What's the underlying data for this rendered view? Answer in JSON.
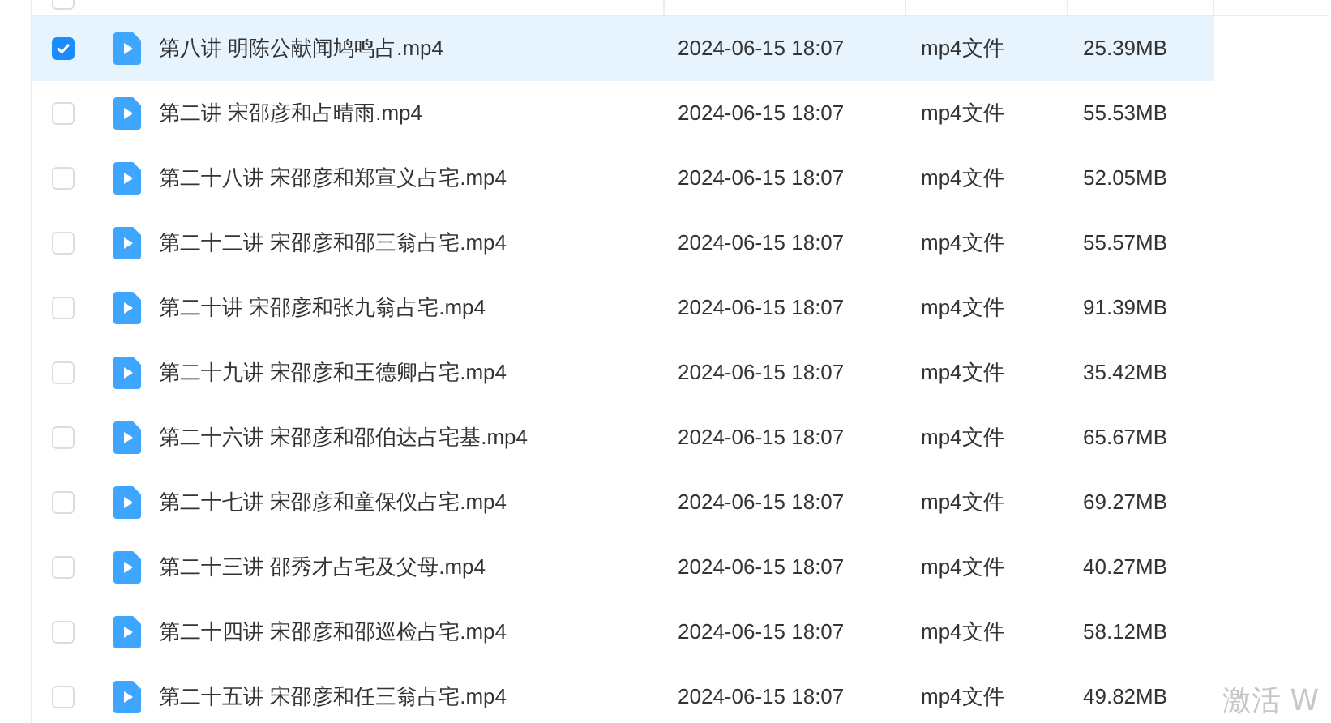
{
  "header": {
    "checked": false
  },
  "files": [
    {
      "name": "第八讲 明陈公献闻鸠鸣占.mp4",
      "modified": "2024-06-15 18:07",
      "type": "mp4文件",
      "size": "25.39MB",
      "selected": true
    },
    {
      "name": "第二讲 宋邵彦和占晴雨.mp4",
      "modified": "2024-06-15 18:07",
      "type": "mp4文件",
      "size": "55.53MB",
      "selected": false
    },
    {
      "name": "第二十八讲 宋邵彦和郑宣义占宅.mp4",
      "modified": "2024-06-15 18:07",
      "type": "mp4文件",
      "size": "52.05MB",
      "selected": false
    },
    {
      "name": "第二十二讲 宋邵彦和邵三翁占宅.mp4",
      "modified": "2024-06-15 18:07",
      "type": "mp4文件",
      "size": "55.57MB",
      "selected": false
    },
    {
      "name": "第二十讲 宋邵彦和张九翁占宅.mp4",
      "modified": "2024-06-15 18:07",
      "type": "mp4文件",
      "size": "91.39MB",
      "selected": false
    },
    {
      "name": "第二十九讲 宋邵彦和王德卿占宅.mp4",
      "modified": "2024-06-15 18:07",
      "type": "mp4文件",
      "size": "35.42MB",
      "selected": false
    },
    {
      "name": "第二十六讲 宋邵彦和邵伯达占宅基.mp4",
      "modified": "2024-06-15 18:07",
      "type": "mp4文件",
      "size": "65.67MB",
      "selected": false
    },
    {
      "name": "第二十七讲 宋邵彦和童保仪占宅.mp4",
      "modified": "2024-06-15 18:07",
      "type": "mp4文件",
      "size": "69.27MB",
      "selected": false
    },
    {
      "name": "第二十三讲 邵秀才占宅及父母.mp4",
      "modified": "2024-06-15 18:07",
      "type": "mp4文件",
      "size": "40.27MB",
      "selected": false
    },
    {
      "name": "第二十四讲 宋邵彦和邵巡检占宅.mp4",
      "modified": "2024-06-15 18:07",
      "type": "mp4文件",
      "size": "58.12MB",
      "selected": false
    },
    {
      "name": "第二十五讲 宋邵彦和任三翁占宅.mp4",
      "modified": "2024-06-15 18:07",
      "type": "mp4文件",
      "size": "49.82MB",
      "selected": false
    }
  ],
  "activation_notice": "激活 W"
}
